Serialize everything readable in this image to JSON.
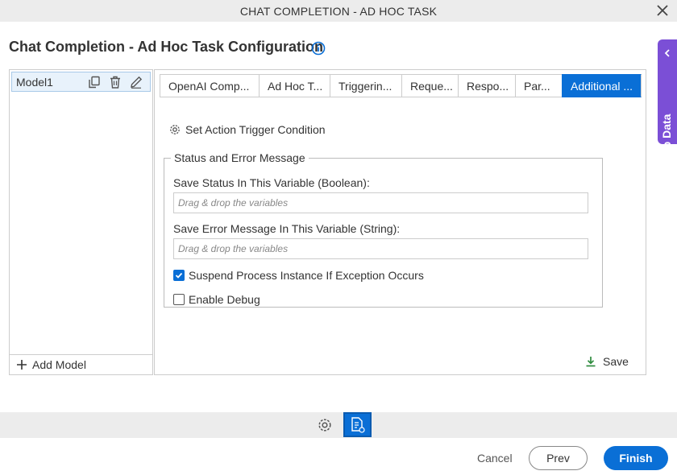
{
  "window": {
    "title": "CHAT COMPLETION - AD HOC TASK"
  },
  "page": {
    "heading": "Chat Completion - Ad Hoc Task Configuration"
  },
  "side_tab": {
    "label": "App Data"
  },
  "models": {
    "items": [
      {
        "name": "Model1"
      }
    ],
    "add_label": "Add Model"
  },
  "tabs": [
    {
      "label": "OpenAI Comp..."
    },
    {
      "label": "Ad Hoc T..."
    },
    {
      "label": "Triggerin..."
    },
    {
      "label": "Reque..."
    },
    {
      "label": "Respo..."
    },
    {
      "label": "Par..."
    },
    {
      "label": "Additional ..."
    }
  ],
  "active_tab_index": 6,
  "content": {
    "trigger_label": "Set Action Trigger Condition",
    "status_group": {
      "legend": "Status and Error Message",
      "save_status_label": "Save Status In This Variable (Boolean):",
      "save_status_placeholder": "Drag & drop the variables",
      "save_error_label": "Save Error Message In This Variable (String):",
      "save_error_placeholder": "Drag & drop the variables",
      "suspend_label": "Suspend Process Instance If Exception Occurs",
      "suspend_checked": true,
      "debug_label": "Enable Debug",
      "debug_checked": false
    },
    "save_label": "Save"
  },
  "footer": {
    "cancel": "Cancel",
    "prev": "Prev",
    "finish": "Finish"
  },
  "colors": {
    "accent": "#0a6fd6",
    "side_tab": "#7b4fd6",
    "save_icon": "#2e8b3e"
  }
}
